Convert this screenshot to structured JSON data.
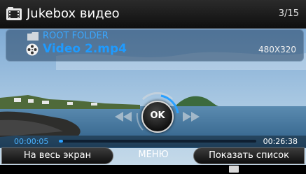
{
  "header": {
    "title": "Jukebox видео",
    "counter": "3/15"
  },
  "info": {
    "folder_name": "ROOT FOLDER",
    "file_name": "Video 2.mp4",
    "resolution": "480X320"
  },
  "controls": {
    "ok_label": "OK"
  },
  "playback": {
    "elapsed": "00:00:05",
    "total": "00:26:38",
    "progress_fraction": 0.003
  },
  "softkeys": {
    "left_label": "На весь экран",
    "middle_label": "МЕНЮ",
    "right_label": "Показать список"
  },
  "colors": {
    "accent": "#1f9bff",
    "folder_text": "#3aa7ff",
    "elapsed_text": "#4ab2ff"
  },
  "icons": {
    "header": "video-folder-icon",
    "folder": "folder-icon",
    "file": "film-reel-icon",
    "prev": "rewind-icon",
    "next": "fast-forward-icon",
    "status": "status-indicator-icon"
  }
}
